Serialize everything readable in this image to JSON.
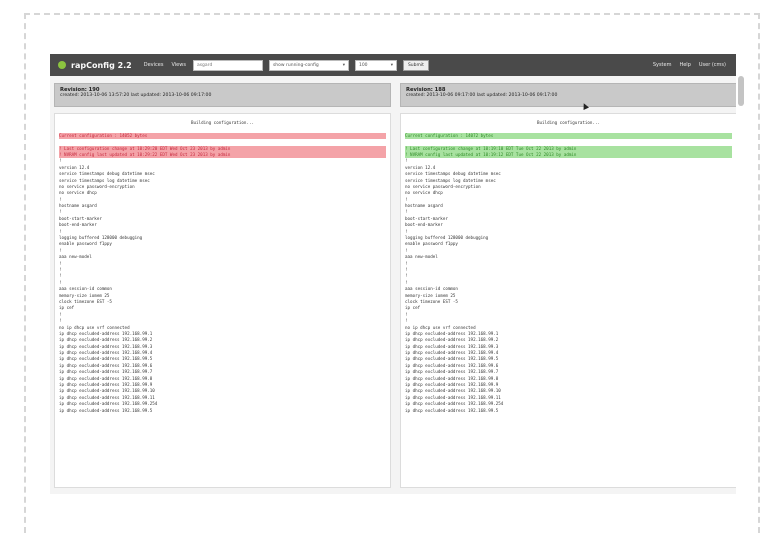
{
  "navbar": {
    "brand": "rapConfig 2.2",
    "menu_items": [
      "Devices",
      "Views"
    ],
    "search_value": "asgard",
    "device_select": "show running-config",
    "count_select": "100",
    "button_label": "Submit",
    "right_items": [
      "System",
      "Help",
      "User (cms)"
    ]
  },
  "left_pane": {
    "title": "Revision: 190",
    "meta": "created: 2013-10-06 13:57:20  last updated: 2013-10-06 09:17:00",
    "lines": [
      {
        "t": "Building configuration...",
        "c": "center"
      },
      {
        "t": "",
        "c": ""
      },
      {
        "t": "Current configuration : 14052 bytes",
        "c": "del"
      },
      {
        "t": "",
        "c": ""
      },
      {
        "t": "! Last configuration change at 10:29:20 EDT Wed Oct 23 2013 by admin",
        "c": "del"
      },
      {
        "t": "! NVRAM config last updated at 10:29:22 EDT Wed Oct 23 2013 by admin",
        "c": "del"
      },
      {
        "t": "!",
        "c": ""
      },
      {
        "t": "version 12.4",
        "c": ""
      },
      {
        "t": "service timestamps debug datetime msec",
        "c": ""
      },
      {
        "t": "service timestamps log datetime msec",
        "c": ""
      },
      {
        "t": "no service password-encryption",
        "c": ""
      },
      {
        "t": "no service dhcp",
        "c": ""
      },
      {
        "t": "!",
        "c": ""
      },
      {
        "t": "hostname asgard",
        "c": ""
      },
      {
        "t": "!",
        "c": ""
      },
      {
        "t": "boot-start-marker",
        "c": ""
      },
      {
        "t": "boot-end-marker",
        "c": ""
      },
      {
        "t": "!",
        "c": ""
      },
      {
        "t": "logging buffered 128000 debugging",
        "c": ""
      },
      {
        "t": "enable password f1ppy",
        "c": ""
      },
      {
        "t": "!",
        "c": ""
      },
      {
        "t": "aaa new-model",
        "c": ""
      },
      {
        "t": "!",
        "c": ""
      },
      {
        "t": "!",
        "c": ""
      },
      {
        "t": "!",
        "c": ""
      },
      {
        "t": "!",
        "c": ""
      },
      {
        "t": "aaa session-id common",
        "c": ""
      },
      {
        "t": "memory-size iomem 25",
        "c": ""
      },
      {
        "t": "clock timezone EST -5",
        "c": ""
      },
      {
        "t": "ip cef",
        "c": ""
      },
      {
        "t": "!",
        "c": ""
      },
      {
        "t": "!",
        "c": ""
      },
      {
        "t": "no ip dhcp use vrf connected",
        "c": ""
      },
      {
        "t": "ip dhcp excluded-address 192.168.99.1",
        "c": ""
      },
      {
        "t": "ip dhcp excluded-address 192.168.99.2",
        "c": ""
      },
      {
        "t": "ip dhcp excluded-address 192.168.99.3",
        "c": ""
      },
      {
        "t": "ip dhcp excluded-address 192.168.99.4",
        "c": ""
      },
      {
        "t": "ip dhcp excluded-address 192.168.99.5",
        "c": ""
      },
      {
        "t": "ip dhcp excluded-address 192.168.99.6",
        "c": ""
      },
      {
        "t": "ip dhcp excluded-address 192.168.99.7",
        "c": ""
      },
      {
        "t": "ip dhcp excluded-address 192.168.99.8",
        "c": ""
      },
      {
        "t": "ip dhcp excluded-address 192.168.99.9",
        "c": ""
      },
      {
        "t": "ip dhcp excluded-address 192.168.99.10",
        "c": ""
      },
      {
        "t": "ip dhcp excluded-address 192.168.99.11",
        "c": ""
      },
      {
        "t": "ip dhcp excluded-address 192.168.99.254",
        "c": ""
      },
      {
        "t": "ip dhcp excluded-address 192.168.99.5",
        "c": ""
      }
    ]
  },
  "right_pane": {
    "title": "Revision: 188",
    "meta": "created: 2013-10-06 09:17:00  last updated: 2013-10-06 09:17:00",
    "lines": [
      {
        "t": "Building configuration...",
        "c": "center"
      },
      {
        "t": "",
        "c": ""
      },
      {
        "t": "Current configuration : 14072 bytes",
        "c": "add"
      },
      {
        "t": "",
        "c": ""
      },
      {
        "t": "! Last configuration change at 10:19:10 EDT Tue Oct 22 2013 by admin",
        "c": "add"
      },
      {
        "t": "! NVRAM config last updated at 10:19:12 EDT Tue Oct 22 2013 by admin",
        "c": "add"
      },
      {
        "t": "!",
        "c": ""
      },
      {
        "t": "version 12.4",
        "c": ""
      },
      {
        "t": "service timestamps debug datetime msec",
        "c": ""
      },
      {
        "t": "service timestamps log datetime msec",
        "c": ""
      },
      {
        "t": "no service password-encryption",
        "c": ""
      },
      {
        "t": "no service dhcp",
        "c": ""
      },
      {
        "t": "!",
        "c": ""
      },
      {
        "t": "hostname asgard",
        "c": ""
      },
      {
        "t": "!",
        "c": ""
      },
      {
        "t": "boot-start-marker",
        "c": ""
      },
      {
        "t": "boot-end-marker",
        "c": ""
      },
      {
        "t": "!",
        "c": ""
      },
      {
        "t": "logging buffered 128000 debugging",
        "c": ""
      },
      {
        "t": "enable password f1ppy",
        "c": ""
      },
      {
        "t": "!",
        "c": ""
      },
      {
        "t": "aaa new-model",
        "c": ""
      },
      {
        "t": "!",
        "c": ""
      },
      {
        "t": "!",
        "c": ""
      },
      {
        "t": "!",
        "c": ""
      },
      {
        "t": "!",
        "c": ""
      },
      {
        "t": "aaa session-id common",
        "c": ""
      },
      {
        "t": "memory-size iomem 25",
        "c": ""
      },
      {
        "t": "clock timezone EST -5",
        "c": ""
      },
      {
        "t": "ip cef",
        "c": ""
      },
      {
        "t": "!",
        "c": ""
      },
      {
        "t": "!",
        "c": ""
      },
      {
        "t": "no ip dhcp use vrf connected",
        "c": ""
      },
      {
        "t": "ip dhcp excluded-address 192.168.99.1",
        "c": ""
      },
      {
        "t": "ip dhcp excluded-address 192.168.99.2",
        "c": ""
      },
      {
        "t": "ip dhcp excluded-address 192.168.99.3",
        "c": ""
      },
      {
        "t": "ip dhcp excluded-address 192.168.99.4",
        "c": ""
      },
      {
        "t": "ip dhcp excluded-address 192.168.99.5",
        "c": ""
      },
      {
        "t": "ip dhcp excluded-address 192.168.99.6",
        "c": ""
      },
      {
        "t": "ip dhcp excluded-address 192.168.99.7",
        "c": ""
      },
      {
        "t": "ip dhcp excluded-address 192.168.99.8",
        "c": ""
      },
      {
        "t": "ip dhcp excluded-address 192.168.99.9",
        "c": ""
      },
      {
        "t": "ip dhcp excluded-address 192.168.99.10",
        "c": ""
      },
      {
        "t": "ip dhcp excluded-address 192.168.99.11",
        "c": ""
      },
      {
        "t": "ip dhcp excluded-address 192.168.99.254",
        "c": ""
      },
      {
        "t": "ip dhcp excluded-address 192.168.99.5",
        "c": ""
      }
    ]
  },
  "colors": {
    "navbar_bg": "#4a4a4a",
    "brand_icon": "#8cc43f",
    "removed_bg": "#f4a3a8",
    "added_bg": "#a8e2a0"
  }
}
